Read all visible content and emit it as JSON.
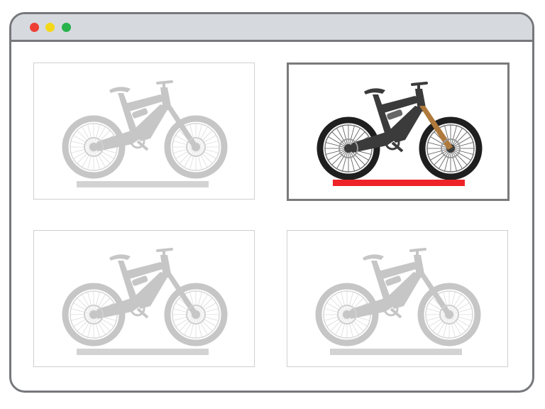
{
  "window": {
    "title": "",
    "controls": [
      {
        "name": "close",
        "color": "#ee3f36"
      },
      {
        "name": "minimize",
        "color": "#f4d818"
      },
      {
        "name": "maximize",
        "color": "#27b24b"
      }
    ]
  },
  "products": [
    {
      "image": "mountain-bike-icon",
      "state": "faded",
      "label_color": "#d3d3d3"
    },
    {
      "image": "mountain-bike-icon",
      "state": "selected",
      "label_color": "#ee2328"
    },
    {
      "image": "mountain-bike-icon",
      "state": "faded",
      "label_color": "#d3d3d3"
    },
    {
      "image": "mountain-bike-icon",
      "state": "faded",
      "label_color": "#d3d3d3"
    }
  ],
  "colors": {
    "window_border": "#76787b",
    "titlebar": "#d6dadf",
    "faded_bike": "#c6c6c6",
    "bike_frame": "#3b3b3b",
    "fork": "#b07a3c",
    "selected_border": "#7a7a7a",
    "selected_label": "#ee2328"
  }
}
